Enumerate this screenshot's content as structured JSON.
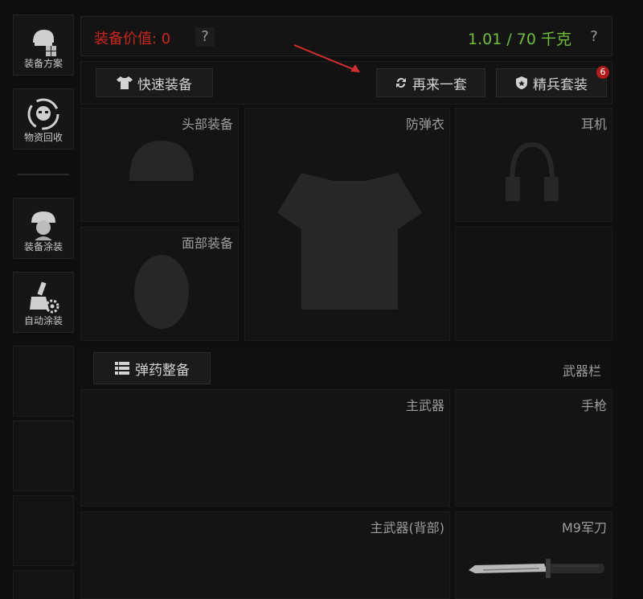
{
  "sidebar": {
    "items": [
      {
        "label": "装备方案",
        "icon": "helmet-grid-icon"
      },
      {
        "label": "物资回收",
        "icon": "recycle-face-icon"
      },
      {
        "label": "装备涂装",
        "icon": "soldier-helmet-icon"
      },
      {
        "label": "自动涂装",
        "icon": "brush-gear-icon"
      }
    ]
  },
  "header": {
    "value_label": "装备价值: 0",
    "value_help": "?",
    "weight": "1.01 / 70 千克",
    "weight_help": "?"
  },
  "actions": {
    "quick_equip": "快速装备",
    "reroll": "再来一套",
    "elite_set": "精兵套装",
    "elite_badge": "6"
  },
  "slots": {
    "head": "头部装备",
    "armor": "防弹衣",
    "headset": "耳机",
    "face": "面部装备",
    "primary": "主武器",
    "pistol": "手枪",
    "primary_back": "主武器(背部)",
    "knife": "M9军刀"
  },
  "ammo": {
    "button": "弹药整备",
    "weapon_bar": "武器栏"
  },
  "colors": {
    "value_red": "#c8281e",
    "weight_green": "#6fbf3a",
    "badge_red": "#b01c1c",
    "annotation_arrow": "#d23030"
  }
}
